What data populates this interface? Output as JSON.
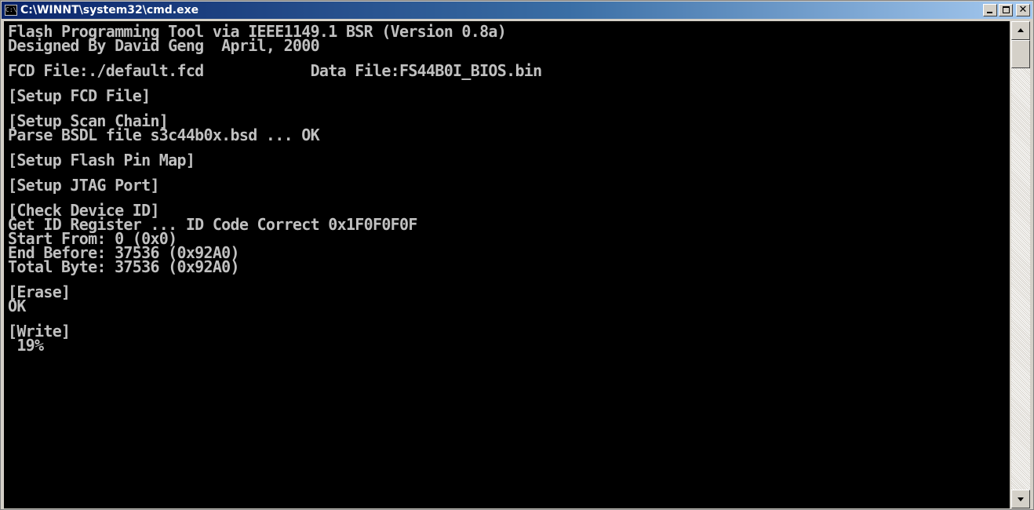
{
  "window": {
    "title": "C:\\WINNT\\system32\\cmd.exe",
    "icon": "console-app-icon"
  },
  "caption_buttons": {
    "minimize": "minimize-icon",
    "maximize": "maximize-icon",
    "close": "close-icon"
  },
  "console": {
    "lines": [
      "Flash Programming Tool via IEEE1149.1 BSR (Version 0.8a)",
      "Designed By David Geng  April, 2000",
      "",
      "FCD File:./default.fcd            Data File:FS44B0I_BIOS.bin",
      "",
      "[Setup FCD File]",
      "",
      "[Setup Scan Chain]",
      "Parse BSDL file s3c44b0x.bsd ... OK",
      "",
      "[Setup Flash Pin Map]",
      "",
      "[Setup JTAG Port]",
      "",
      "[Check Device ID]",
      "Get ID Register ... ID Code Correct 0x1F0F0F0F",
      "Start From: 0 (0x0)",
      "End Before: 37536 (0x92A0)",
      "Total Byte: 37536 (0x92A0)",
      "",
      "[Erase]",
      "OK",
      "",
      "[Write]",
      " 19%"
    ]
  },
  "colors": {
    "console_bg": "#000000",
    "console_fg": "#c0c0c0",
    "titlebar_start": "#0a246a",
    "titlebar_end": "#a6caf0"
  }
}
